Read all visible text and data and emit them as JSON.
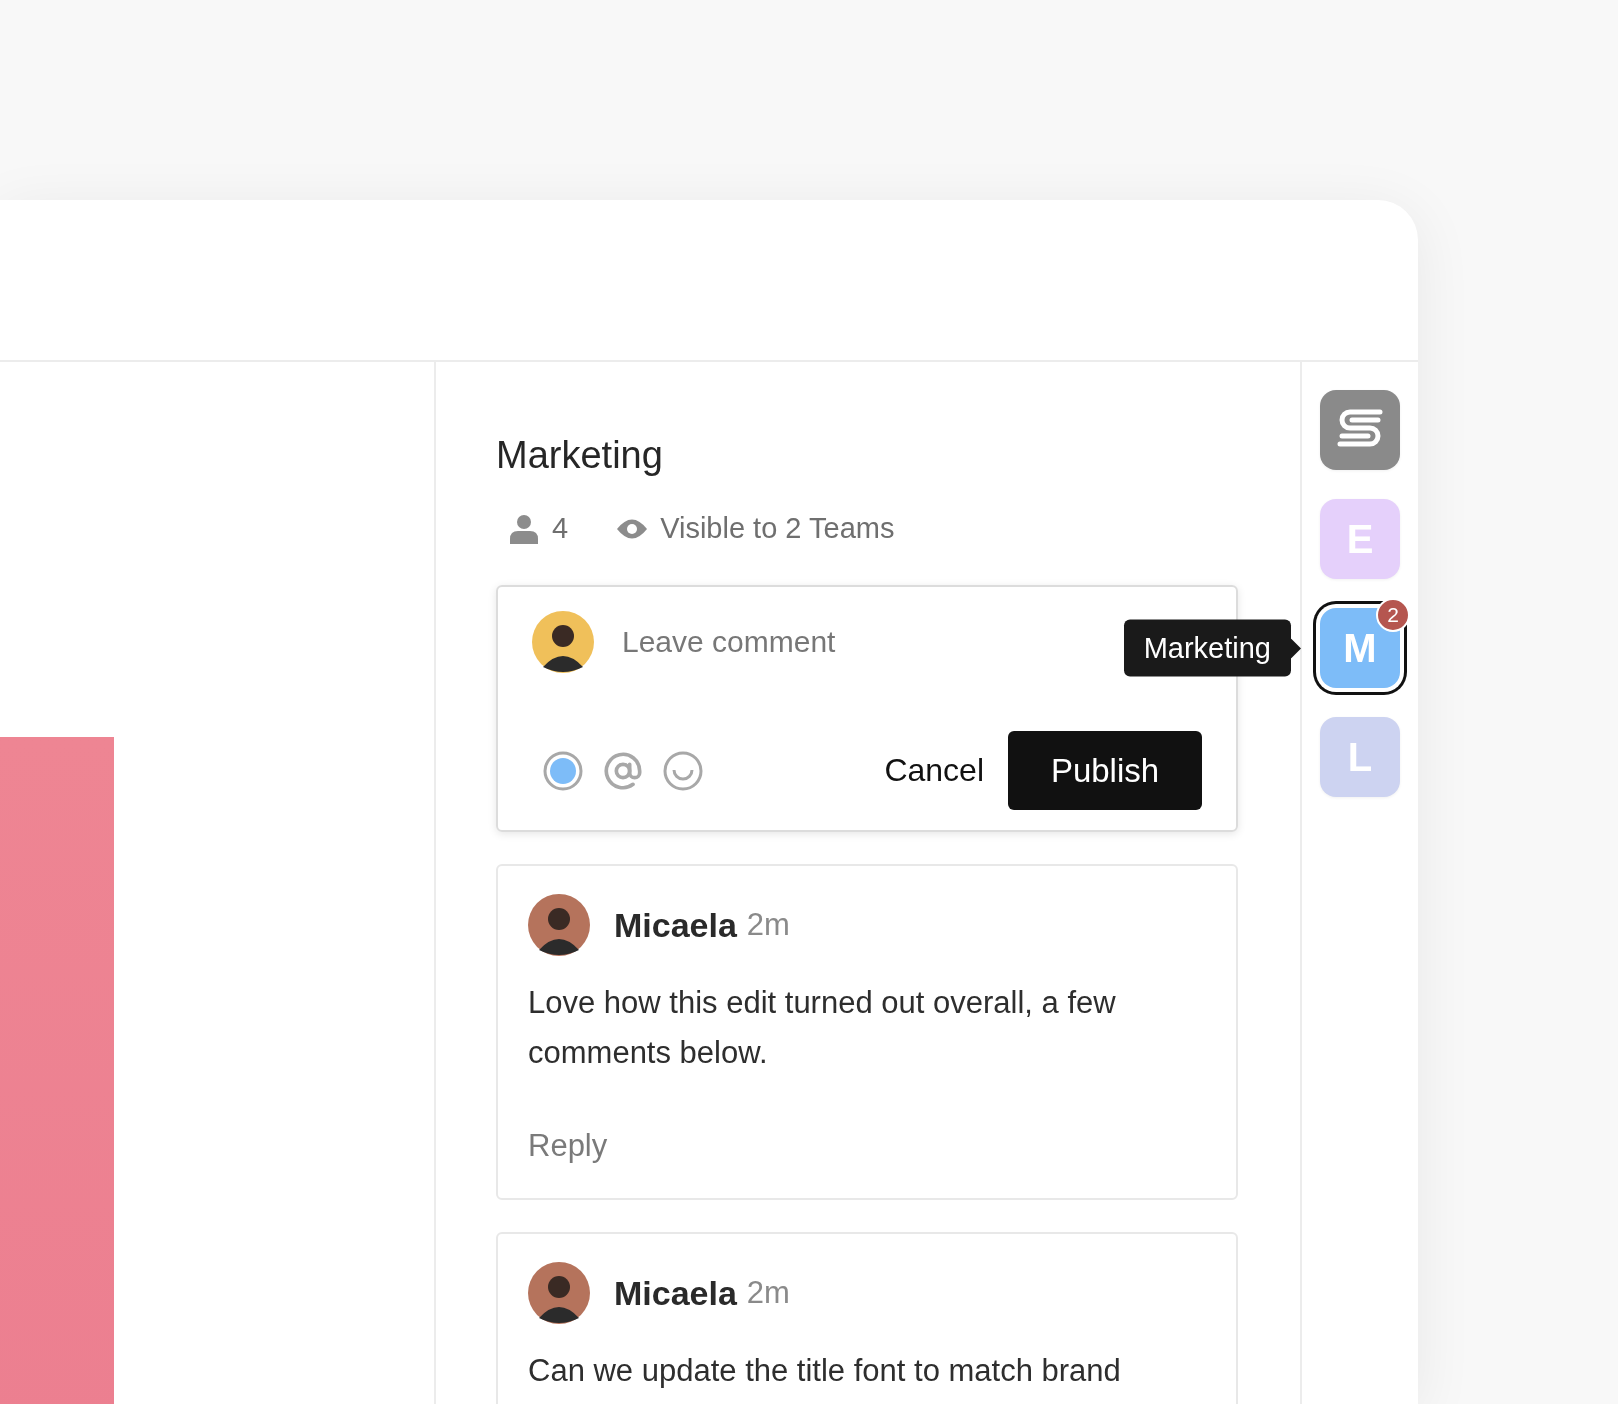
{
  "panel": {
    "title": "Marketing",
    "members": "4",
    "visibility": "Visible to 2 Teams"
  },
  "composer": {
    "placeholder": "Leave comment",
    "tools": [
      {
        "kind": "record"
      },
      {
        "kind": "mention"
      },
      {
        "kind": "emoji"
      }
    ],
    "cancel": "Cancel",
    "publish": "Publish"
  },
  "comments": [
    {
      "author": "Micaela",
      "time": "2m",
      "text": "Love how this edit turned out overall, a few comments below.",
      "reply": "Reply"
    },
    {
      "author": "Micaela",
      "time": "2m",
      "text": "Can we update the title font to match brand"
    }
  ],
  "rail": {
    "items": [
      {
        "kind": "logo",
        "selected": false
      },
      {
        "kind": "letter",
        "label": "E",
        "color": "#e5d0fb",
        "selected": false
      },
      {
        "kind": "letter",
        "label": "M",
        "color": "#7dbcf8",
        "selected": true,
        "badge": "2",
        "tooltip": "Marketing"
      },
      {
        "kind": "letter",
        "label": "L",
        "color": "#cdd3f1",
        "selected": false
      }
    ]
  }
}
